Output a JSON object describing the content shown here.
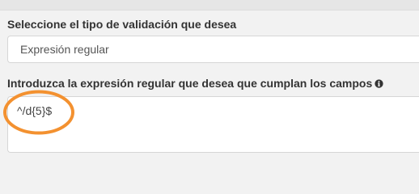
{
  "form": {
    "validation_type_label": "Seleccione el tipo de validación que desea",
    "validation_type_value": "Expresión regular",
    "regex_label": "Introduzca la expresión regular que desea que cumplan los campos",
    "regex_value": "^/d{5}$"
  },
  "icons": {
    "info": "info-circle-icon",
    "annotation": "orange-ellipse-annotation"
  },
  "colors": {
    "annotation": "#f39130",
    "label_text": "#333333",
    "field_border": "#d6d6d6",
    "background": "#f2f2f2"
  }
}
